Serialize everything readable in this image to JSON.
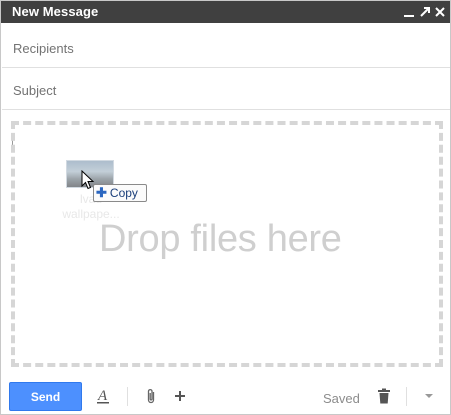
{
  "titlebar": {
    "title": "New Message",
    "buttons": [
      {
        "name": "minimize",
        "icon": "minimize-icon"
      },
      {
        "name": "pop-out",
        "icon": "expand-arrow-icon"
      },
      {
        "name": "close",
        "icon": "close-icon"
      }
    ]
  },
  "fields": {
    "recipients_placeholder": "Recipients",
    "recipients_value": "",
    "subject_placeholder": "Subject",
    "subject_value": ""
  },
  "body": {
    "drop_text": "Drop files here",
    "drag_item": {
      "name": "lval wallpape...",
      "name_lines": [
        "lvau",
        "wallpape..."
      ],
      "tooltip": "Copy"
    }
  },
  "toolbar": {
    "send_label": "Send",
    "status": "Saved",
    "icons": [
      "text-format-icon",
      "paperclip-icon",
      "plus-icon",
      "trash-icon",
      "dropdown-arrow-icon"
    ]
  },
  "colors": {
    "titlebar_bg": "#404040",
    "send_button": "#4d90fe",
    "dropzone_border": "#d6d6d6",
    "drop_text": "#cfcfcf"
  }
}
